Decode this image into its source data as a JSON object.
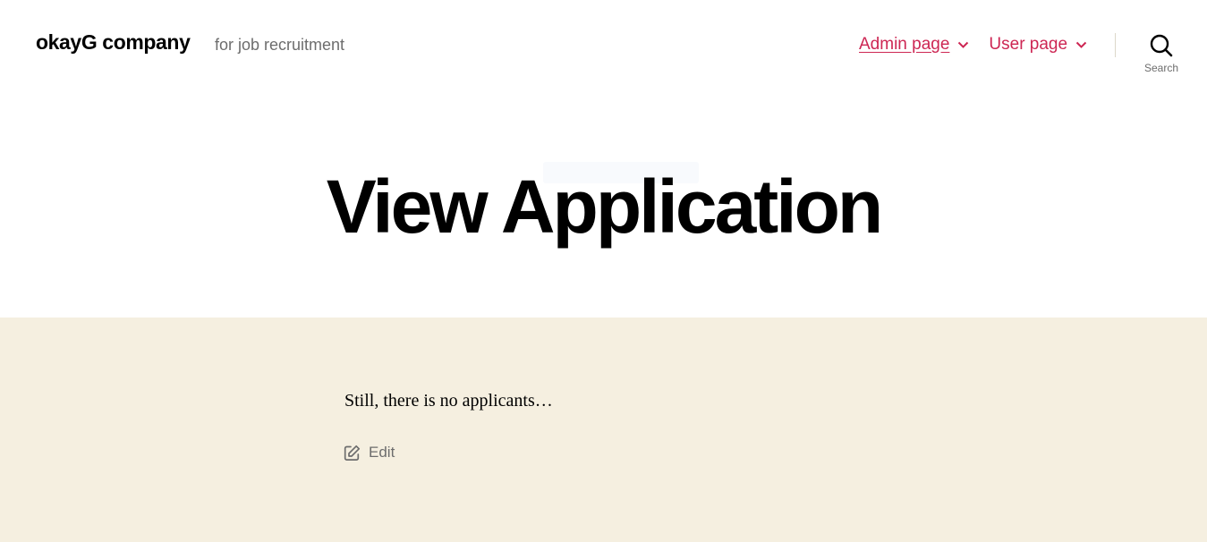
{
  "header": {
    "site_title": "okayG company",
    "tagline": "for job recruitment",
    "nav": [
      {
        "label": "Admin page",
        "current": true
      },
      {
        "label": "User page",
        "current": false
      }
    ],
    "search_label": "Search"
  },
  "main": {
    "title": "View Application",
    "message": "Still, there is no applicants…",
    "edit_label": "Edit"
  },
  "colors": {
    "accent": "#cd2653",
    "content_background": "#f5efe0",
    "muted_text": "#6d6d6d"
  },
  "icons": {
    "nav_dropdown": "chevron-down-icon",
    "search": "search-icon",
    "edit": "edit-icon"
  }
}
